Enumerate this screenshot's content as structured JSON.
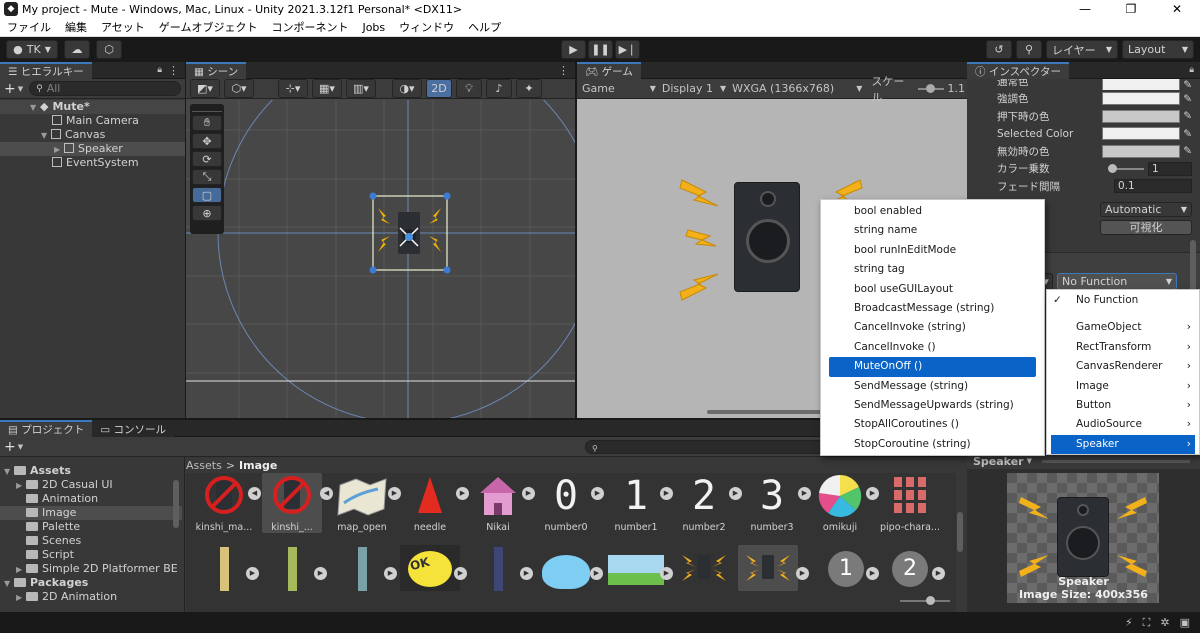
{
  "window": {
    "title": "My project - Mute - Windows, Mac, Linux - Unity 2021.3.12f1 Personal* <DX11>",
    "app_icon": "unity-icon",
    "minimize": "—",
    "maximize": "❐",
    "close": "✕"
  },
  "menubar": [
    "ファイル",
    "編集",
    "アセット",
    "ゲームオブジェクト",
    "コンポーネント",
    "Jobs",
    "ウィンドウ",
    "ヘルプ"
  ],
  "toolbar": {
    "account": "TK",
    "layers": "レイヤー",
    "layout": "Layout"
  },
  "hierarchy": {
    "tab": "ヒエラルキー",
    "search_placeholder": "All",
    "items": [
      {
        "label": "Mute*",
        "level": 0
      },
      {
        "label": "Main Camera",
        "level": 1
      },
      {
        "label": "Canvas",
        "level": 1
      },
      {
        "label": "Speaker",
        "level": 2
      },
      {
        "label": "EventSystem",
        "level": 1
      }
    ]
  },
  "scene": {
    "tab": "シーン",
    "mode_2d": "2D"
  },
  "game": {
    "tab": "ゲーム",
    "view": "Game",
    "display": "Display 1",
    "resolution": "WXGA (1366x768)",
    "scale_label": "スケール",
    "scale_value": "1.1"
  },
  "inspector": {
    "tab": "インスペクター",
    "rows": [
      {
        "label": "通常色"
      },
      {
        "label": "強調色"
      },
      {
        "label": "押下時の色"
      },
      {
        "label": "Selected Color"
      },
      {
        "label": "無効時の色"
      }
    ],
    "color_multiplier_label": "カラー乗数",
    "color_multiplier_value": "1",
    "fade_label": "フェード間隔",
    "fade_value": "0.1",
    "navigation": "Automatic",
    "visualize": "可視化",
    "function_select": "No Function",
    "preview_object": "Speaker",
    "preview_name": "Speaker",
    "preview_size": "Image Size: 400x356"
  },
  "function_menu": {
    "items": [
      "No Function",
      "GameObject",
      "RectTransform",
      "CanvasRenderer",
      "Image",
      "Button",
      "AudioSource",
      "Speaker"
    ],
    "checked": "No Function",
    "highlighted": "Speaker"
  },
  "method_menu": {
    "items": [
      "bool enabled",
      "string name",
      "bool runInEditMode",
      "string tag",
      "bool useGUILayout",
      "BroadcastMessage (string)",
      "CancelInvoke (string)",
      "CancelInvoke ()",
      "MuteOnOff ()",
      "SendMessage (string)",
      "SendMessageUpwards (string)",
      "StopAllCoroutines ()",
      "StopCoroutine (string)"
    ],
    "highlighted": "MuteOnOff ()"
  },
  "project": {
    "tab_project": "プロジェクト",
    "tab_console": "コンソール",
    "tree": [
      {
        "label": "Assets",
        "level": 0,
        "bold": true
      },
      {
        "label": "2D Casual UI",
        "level": 1
      },
      {
        "label": "Animation",
        "level": 1
      },
      {
        "label": "Image",
        "level": 1,
        "selected": true
      },
      {
        "label": "Palette",
        "level": 1
      },
      {
        "label": "Scenes",
        "level": 1
      },
      {
        "label": "Script",
        "level": 1
      },
      {
        "label": "Simple 2D Platformer BE",
        "level": 1
      },
      {
        "label": "Packages",
        "level": 0,
        "bold": true
      },
      {
        "label": "2D Animation",
        "level": 1
      }
    ],
    "breadcrumb_root": "Assets",
    "breadcrumb_sep": ">",
    "breadcrumb_current": "Image",
    "assets_row1": [
      "kinshi_ma...",
      "kinshi_...",
      "map_open",
      "needle",
      "Nikai",
      "number0",
      "number1",
      "number2",
      "number3",
      "omikuji",
      "pipo-chara..."
    ],
    "number_glyphs": [
      "0",
      "1",
      "2",
      "3"
    ],
    "circle_numbers": [
      "1",
      "2"
    ],
    "ok_text": "OK"
  }
}
